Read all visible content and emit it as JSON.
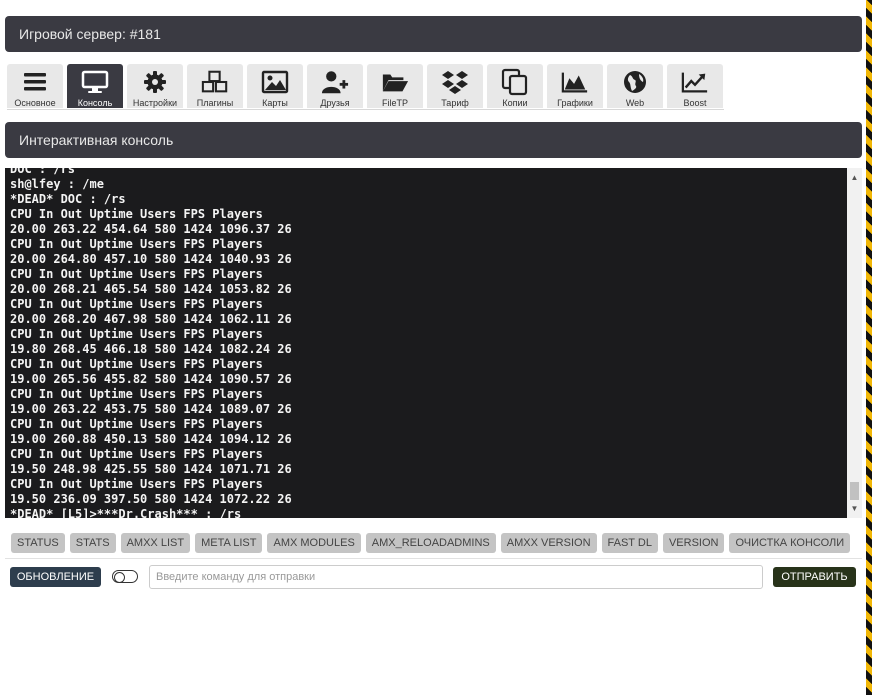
{
  "server_header": {
    "title": "Игровой сервер: #181"
  },
  "tabs": [
    {
      "label": "Основное",
      "icon": "menu-icon"
    },
    {
      "label": "Консоль",
      "icon": "monitor-icon",
      "active": true
    },
    {
      "label": "Настройки",
      "icon": "gear-icon"
    },
    {
      "label": "Плагины",
      "icon": "cubes-icon"
    },
    {
      "label": "Карты",
      "icon": "image-icon"
    },
    {
      "label": "Друзья",
      "icon": "user-plus-icon"
    },
    {
      "label": "FileTP",
      "icon": "folder-open-icon"
    },
    {
      "label": "Тариф",
      "icon": "dropbox-icon"
    },
    {
      "label": "Копии",
      "icon": "copy-icon"
    },
    {
      "label": "Графики",
      "icon": "area-chart-icon"
    },
    {
      "label": "Web",
      "icon": "globe-icon"
    },
    {
      "label": "Boost",
      "icon": "line-chart-icon"
    }
  ],
  "console_header": {
    "title": "Интерактивная консоль"
  },
  "console": {
    "lines": [
      "DOC : /rs",
      "sh@lfey : /me",
      "*DEAD* DOC : /rs",
      "CPU In Out Uptime Users FPS Players",
      "20.00 263.22 454.64 580 1424 1096.37 26",
      "CPU In Out Uptime Users FPS Players",
      "20.00 264.80 457.10 580 1424 1040.93 26",
      "CPU In Out Uptime Users FPS Players",
      "20.00 268.21 465.54 580 1424 1053.82 26",
      "CPU In Out Uptime Users FPS Players",
      "20.00 268.20 467.98 580 1424 1062.11 26",
      "CPU In Out Uptime Users FPS Players",
      "19.80 268.45 466.18 580 1424 1082.24 26",
      "CPU In Out Uptime Users FPS Players",
      "19.00 265.56 455.82 580 1424 1090.57 26",
      "CPU In Out Uptime Users FPS Players",
      "19.00 263.22 453.75 580 1424 1089.07 26",
      "CPU In Out Uptime Users FPS Players",
      "19.00 260.88 450.13 580 1424 1094.12 26",
      "CPU In Out Uptime Users FPS Players",
      "19.50 248.98 425.55 580 1424 1071.71 26",
      "CPU In Out Uptime Users FPS Players",
      "19.50 236.09 397.50 580 1424 1072.22 26",
      "*DEAD* [L5]>***Dr.Crash*** : /rs"
    ]
  },
  "quick_commands": [
    "STATUS",
    "STATS",
    "AMXX LIST",
    "META LIST",
    "AMX MODULES",
    "AMX_RELOADADMINS",
    "AMXX VERSION",
    "FAST DL",
    "VERSION",
    "ОЧИСТКА КОНСОЛИ"
  ],
  "controls": {
    "update_label": "ОБНОВЛЕНИЕ",
    "input_placeholder": "Введите команду для отправки",
    "input_value": "",
    "send_label": "ОТПРАВИТЬ"
  },
  "colors": {
    "header_bg": "#3a3a42",
    "console_bg": "#1b1b1d",
    "update_btn": "#2d3d4d",
    "send_btn": "#28331a",
    "quick_cmd_bg": "#c4c4c4"
  }
}
